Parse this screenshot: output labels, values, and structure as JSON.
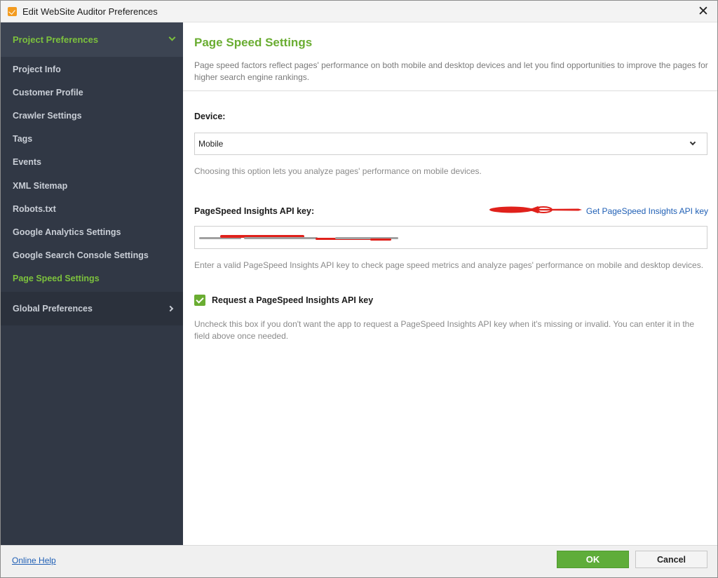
{
  "window": {
    "title": "Edit WebSite Auditor Preferences",
    "close_icon": "close-icon"
  },
  "sidebar": {
    "group_label": "Project Preferences",
    "items": [
      {
        "label": "Project Info",
        "active": false
      },
      {
        "label": "Customer Profile",
        "active": false
      },
      {
        "label": "Crawler Settings",
        "active": false
      },
      {
        "label": "Tags",
        "active": false
      },
      {
        "label": "Events",
        "active": false
      },
      {
        "label": "XML Sitemap",
        "active": false
      },
      {
        "label": "Robots.txt",
        "active": false
      },
      {
        "label": "Google Analytics Settings",
        "active": false
      },
      {
        "label": "Google Search Console Settings",
        "active": false
      },
      {
        "label": "Page Speed Settings",
        "active": true
      }
    ],
    "global_label": "Global Preferences"
  },
  "main": {
    "title": "Page Speed Settings",
    "description": "Page speed factors reflect pages' performance on both mobile and desktop devices and let you find opportunities to improve the pages for higher search engine rankings.",
    "device": {
      "label": "Device:",
      "value": "Mobile",
      "hint": "Choosing this option lets you analyze pages' performance on mobile devices."
    },
    "api_key": {
      "label": "PageSpeed Insights API key:",
      "link": "Get PageSpeed Insights API key",
      "value_redacted": true,
      "hint": "Enter a valid PageSpeed Insights API key to check page speed metrics and analyze pages' performance on mobile and desktop devices."
    },
    "request_key": {
      "label": "Request a PageSpeed Insights API key",
      "checked": true,
      "hint": "Uncheck this box if you don't want the app to request a PageSpeed Insights API key when it's missing or invalid. You can enter it in the field above once needed."
    }
  },
  "footer": {
    "help_link": "Online Help",
    "ok_label": "OK",
    "cancel_label": "Cancel"
  },
  "colors": {
    "accent_green": "#6aad32",
    "sidebar_bg": "#313845",
    "link_blue": "#1f5fb5",
    "annotation_red": "#e0211b"
  }
}
